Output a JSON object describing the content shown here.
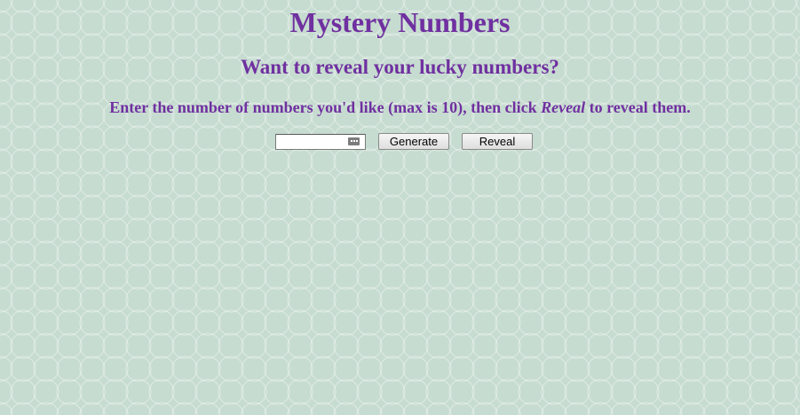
{
  "header": {
    "title": "Mystery Numbers",
    "subtitle": "Want to reveal your lucky numbers?"
  },
  "instructions": {
    "before": "Enter the number of numbers you'd like (max is 10), then click ",
    "emphasis": "Reveal",
    "after": " to reveal them."
  },
  "controls": {
    "number_input_value": "",
    "generate_label": "Generate",
    "reveal_label": "Reveal"
  },
  "colors": {
    "text": "#7030a0",
    "background": "#c6dcd0"
  }
}
